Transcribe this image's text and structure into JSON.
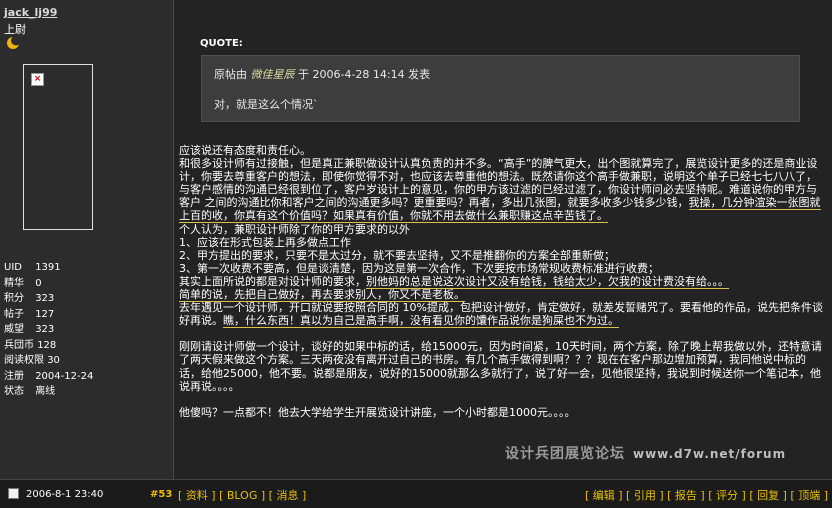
{
  "user": {
    "name": "jack_lj99",
    "rank": "上尉",
    "rank_icon": "moon-icon",
    "stats": [
      {
        "k": "UID",
        "v": "1391"
      },
      {
        "k": "精华",
        "v": "0"
      },
      {
        "k": "积分",
        "v": "323"
      },
      {
        "k": "帖子",
        "v": "127"
      },
      {
        "k": "威望",
        "v": "323"
      },
      {
        "k": "兵団币",
        "v": "128"
      },
      {
        "k": "阅读权限",
        "v": "30"
      },
      {
        "k": "注册",
        "v": "2004-12-24"
      },
      {
        "k": "状态",
        "v": "离线"
      }
    ]
  },
  "quote": {
    "label": "QUOTE:",
    "prefix": "原帖由",
    "author": "微佳星辰",
    "suffix": "于 2006-4-28 14:14 发表",
    "text": "对，就是这么个情况`"
  },
  "post_body": {
    "p1": "应该说还有态度和责任心。",
    "p2a": "和很多设计师有过接触，但是真正兼职做设计认真负责的并不多。“高手”的脾气更大，出个图就算完了，展览设计更多的还是商业设计，你要去尊重客户的想法，即使你觉得不对，也应该去尊重他的想法。既然请你这个高手做兼职，说明这个单子已经七七八八了，与客户感情的沟通已经很到位了，客户岁设计上的意见，你的甲方该过滤的已经过滤了，你设计师问必去坚持呢。难道说你的甲方与客户 之间的沟通比你和客户之间的沟通更多吗？更重要吗？再者，多出几张图，就要多收多少钱多少钱，",
    "p2b": "我操，几分钟渲染一张图就上百的收，你真有这个价值吗？如果真有价值，你就不用去做什么兼职赚这点辛苦钱了。",
    "p3": "个人认为，兼职设计师除了你的甲方要求的以外",
    "p4": "1、应该在形式包装上再多做点工作",
    "p5": "2、甲方提出的要求，只要不是太过分，就不要去坚持，又不是推翻你的方案全部重新做；",
    "p6": "3、第一次收费不要高，但是谈清楚，因为这是第一次合作，下次要按市场常规收费标准进行收费；",
    "p7a": "其实上面所说的都是对设计师的要求，",
    "p7b": "别他妈的总是说这次设计又没有给钱，钱给太少，欠我的设计费没有给。。。",
    "p8": "简单的说，先把自己做好，再去要求别人，你又不是老板。",
    "p9a": "去年遇见一个设计师，开口就说要按照合同的 10%提成，包把设计做好，肯定做好，就差发誓赌咒了。要看他的作品，说先把条件谈好再说。",
    "p9b": "瞧，什么东西！真以为自己是高手啊，没有看见你的馕作品说你是狗屎也不为过。",
    "p10": "刚刚请设计师做一个设计，谈好的如果中标的话，给15000元，因为时间紧，10天时间，两个方案，除了晚上帮我做以外，还特意请了两天假来做这个方案。三天两夜没有离开过自己的书房。有几个高手做得到啊？？？现在在客户那边增加预算，我同他说中标的话，给他25000，他不要。说都是朋友，说好的15000就那么多就行了，说了好一会，见他很坚持，我说到时候送你一个笔记本，他说再说。。。。",
    "p11": "他傻吗？一点都不！他去大学给学生开展览设计讲座，一个小时都是1000元。。。。"
  },
  "watermark": {
    "cn": "设计兵团展览论坛",
    "url": "www.d7w.net/forum"
  },
  "footer": {
    "date": "2006-8-1 23:40",
    "post_number": "#53",
    "left_links": [
      "资料",
      "BLOG",
      "消息"
    ],
    "right_links": [
      "编辑",
      "引用",
      "报告",
      "评分",
      "回复",
      "顶端"
    ]
  }
}
